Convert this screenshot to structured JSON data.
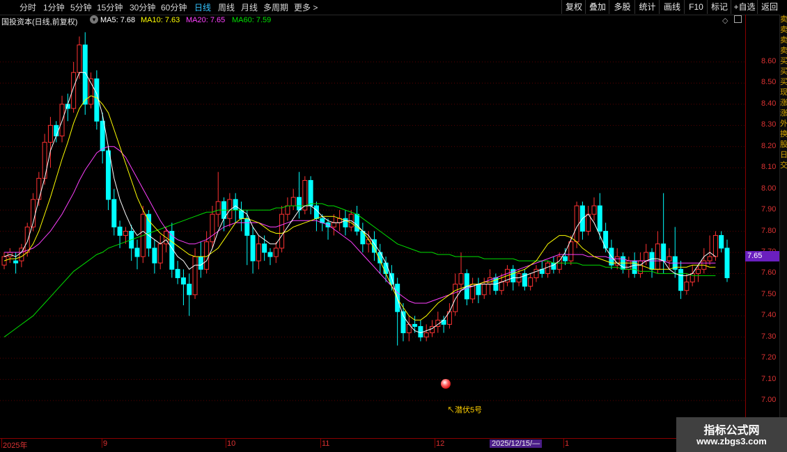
{
  "toolbar": {
    "periods": [
      "分时",
      "1分钟",
      "5分钟",
      "15分钟",
      "30分钟",
      "60分钟",
      "日线",
      "周线",
      "月线",
      "多周期",
      "更多 >"
    ],
    "active_period": "日线",
    "buttons": [
      "复权",
      "叠加",
      "多股",
      "统计",
      "画线",
      "F10",
      "标记",
      "+自选",
      "返回"
    ]
  },
  "info": {
    "stock": "国投资本(日线,前复权)",
    "ma5": "MA5: 7.68",
    "ma10": "MA10: 7.63",
    "ma20": "MA20: 7.65",
    "ma60": "MA60: 7.59",
    "colors": {
      "ma5": "#ffffff",
      "ma10": "#ffff00",
      "ma20": "#ff40ff",
      "ma60": "#00e000"
    }
  },
  "y_axis": {
    "labels": [
      "8.60",
      "8.50",
      "8.40",
      "8.30",
      "8.20",
      "8.10",
      "8.00",
      "7.90",
      "7.80",
      "7.70",
      "7.60",
      "7.50",
      "7.40",
      "7.30",
      "7.20",
      "7.10",
      "7.00"
    ]
  },
  "price_tag": "7.65",
  "x_axis": {
    "labels": [
      "2025年",
      "9",
      "10",
      "11",
      "12",
      "1"
    ],
    "selected_date": "2025/12/15/—"
  },
  "signal_label": "↖潜伏5号",
  "watermark": {
    "line1": "指标公式网",
    "line2": "www.zbgs3.com"
  },
  "right_strip_text": [
    "卖",
    "卖",
    "卖",
    "卖",
    "买",
    "买",
    "买",
    "现",
    "涨",
    "涨",
    "外",
    "换",
    "股",
    "日",
    "交"
  ],
  "chart_data": {
    "type": "candlestick",
    "title": "国投资本(日线,前复权)",
    "ylim": [
      7.0,
      8.6
    ],
    "up_color": "#ff3232",
    "down_color": "#00ffff",
    "series_ma": [
      {
        "name": "MA5",
        "color": "#ffffff"
      },
      {
        "name": "MA10",
        "color": "#ffff00"
      },
      {
        "name": "MA20",
        "color": "#ff40ff"
      },
      {
        "name": "MA60",
        "color": "#00e000"
      }
    ],
    "candles": [
      [
        7.64,
        7.68,
        7.62,
        7.7
      ],
      [
        7.68,
        7.7,
        7.65,
        7.72
      ],
      [
        7.66,
        7.65,
        7.6,
        7.7
      ],
      [
        7.66,
        7.72,
        7.63,
        7.74
      ],
      [
        7.7,
        7.82,
        7.68,
        7.84
      ],
      [
        7.82,
        7.95,
        7.8,
        7.98
      ],
      [
        7.95,
        8.05,
        7.92,
        8.08
      ],
      [
        8.05,
        8.22,
        8.02,
        8.26
      ],
      [
        8.22,
        8.3,
        8.1,
        8.34
      ],
      [
        8.3,
        8.25,
        8.22,
        8.32
      ],
      [
        8.25,
        8.4,
        8.22,
        8.44
      ],
      [
        8.4,
        8.38,
        8.32,
        8.45
      ],
      [
        8.38,
        8.55,
        8.36,
        8.6
      ],
      [
        8.55,
        8.68,
        8.52,
        8.72
      ],
      [
        8.68,
        8.4,
        8.35,
        8.74
      ],
      [
        8.4,
        8.52,
        8.38,
        8.55
      ],
      [
        8.52,
        8.32,
        8.28,
        8.56
      ],
      [
        8.32,
        8.18,
        8.12,
        8.36
      ],
      [
        8.18,
        7.95,
        7.9,
        8.2
      ],
      [
        7.95,
        7.82,
        7.78,
        8.0
      ],
      [
        7.82,
        7.78,
        7.72,
        7.85
      ],
      [
        7.78,
        7.8,
        7.74,
        7.82
      ],
      [
        7.8,
        7.72,
        7.66,
        7.83
      ],
      [
        7.72,
        7.68,
        7.62,
        7.76
      ],
      [
        7.68,
        7.88,
        7.65,
        7.92
      ],
      [
        7.88,
        7.72,
        7.68,
        7.9
      ],
      [
        7.72,
        7.65,
        7.6,
        7.76
      ],
      [
        7.65,
        7.74,
        7.62,
        7.78
      ],
      [
        7.74,
        7.8,
        7.7,
        7.82
      ],
      [
        7.8,
        7.62,
        7.58,
        7.84
      ],
      [
        7.62,
        7.58,
        7.55,
        7.66
      ],
      [
        7.58,
        7.55,
        7.45,
        7.62
      ],
      [
        7.55,
        7.5,
        7.4,
        7.6
      ],
      [
        7.5,
        7.68,
        7.48,
        7.72
      ],
      [
        7.68,
        7.62,
        7.58,
        7.75
      ],
      [
        7.62,
        7.75,
        7.6,
        7.8
      ],
      [
        7.75,
        7.88,
        7.72,
        7.92
      ],
      [
        7.88,
        7.94,
        7.82,
        8.08
      ],
      [
        7.94,
        7.86,
        7.8,
        7.96
      ],
      [
        7.86,
        7.95,
        7.82,
        7.98
      ],
      [
        7.95,
        7.9,
        7.84,
        7.98
      ],
      [
        7.9,
        7.86,
        7.8,
        7.94
      ],
      [
        7.86,
        7.78,
        7.64,
        7.9
      ],
      [
        7.78,
        7.66,
        7.6,
        7.82
      ],
      [
        7.66,
        7.74,
        7.62,
        7.78
      ],
      [
        7.74,
        7.7,
        7.66,
        7.78
      ],
      [
        7.7,
        7.68,
        7.64,
        7.72
      ],
      [
        7.68,
        7.72,
        7.65,
        7.75
      ],
      [
        7.72,
        7.88,
        7.7,
        7.92
      ],
      [
        7.88,
        7.92,
        7.85,
        7.96
      ],
      [
        7.92,
        7.96,
        7.9,
        8.0
      ],
      [
        7.96,
        7.9,
        7.86,
        8.08
      ],
      [
        7.9,
        8.04,
        7.88,
        8.06
      ],
      [
        8.04,
        7.92,
        7.88,
        8.06
      ],
      [
        7.92,
        7.86,
        7.8,
        7.94
      ],
      [
        7.86,
        7.84,
        7.8,
        7.88
      ],
      [
        7.84,
        7.82,
        7.76,
        7.86
      ],
      [
        7.82,
        7.84,
        7.78,
        7.88
      ],
      [
        7.84,
        7.86,
        7.8,
        7.9
      ],
      [
        7.86,
        7.82,
        7.78,
        7.9
      ],
      [
        7.82,
        7.88,
        7.8,
        7.9
      ],
      [
        7.88,
        7.8,
        7.78,
        7.92
      ],
      [
        7.8,
        7.74,
        7.7,
        7.84
      ],
      [
        7.74,
        7.76,
        7.7,
        7.8
      ],
      [
        7.76,
        7.7,
        7.66,
        7.8
      ],
      [
        7.7,
        7.65,
        7.6,
        7.74
      ],
      [
        7.65,
        7.6,
        7.56,
        7.68
      ],
      [
        7.6,
        7.55,
        7.52,
        7.64
      ],
      [
        7.55,
        7.42,
        7.26,
        7.58
      ],
      [
        7.42,
        7.32,
        7.28,
        7.46
      ],
      [
        7.32,
        7.36,
        7.28,
        7.4
      ],
      [
        7.36,
        7.35,
        7.32,
        7.4
      ],
      [
        7.35,
        7.3,
        7.28,
        7.38
      ],
      [
        7.3,
        7.32,
        7.28,
        7.36
      ],
      [
        7.32,
        7.35,
        7.3,
        7.38
      ],
      [
        7.35,
        7.38,
        7.32,
        7.42
      ],
      [
        7.38,
        7.36,
        7.32,
        7.4
      ],
      [
        7.36,
        7.42,
        7.34,
        7.46
      ],
      [
        7.42,
        7.55,
        7.4,
        7.6
      ],
      [
        7.55,
        7.6,
        7.52,
        7.7
      ],
      [
        7.6,
        7.48,
        7.45,
        7.62
      ],
      [
        7.48,
        7.55,
        7.46,
        7.58
      ],
      [
        7.55,
        7.5,
        7.46,
        7.58
      ],
      [
        7.5,
        7.55,
        7.48,
        7.58
      ],
      [
        7.55,
        7.58,
        7.5,
        7.62
      ],
      [
        7.58,
        7.52,
        7.5,
        7.6
      ],
      [
        7.52,
        7.56,
        7.5,
        7.6
      ],
      [
        7.56,
        7.62,
        7.54,
        7.64
      ],
      [
        7.62,
        7.56,
        7.52,
        7.64
      ],
      [
        7.56,
        7.6,
        7.54,
        7.62
      ],
      [
        7.6,
        7.54,
        7.52,
        7.62
      ],
      [
        7.54,
        7.58,
        7.52,
        7.6
      ],
      [
        7.58,
        7.62,
        7.56,
        7.64
      ],
      [
        7.62,
        7.6,
        7.58,
        7.66
      ],
      [
        7.6,
        7.65,
        7.58,
        7.66
      ],
      [
        7.65,
        7.62,
        7.6,
        7.68
      ],
      [
        7.62,
        7.68,
        7.6,
        7.7
      ],
      [
        7.68,
        7.66,
        7.64,
        7.72
      ],
      [
        7.66,
        7.75,
        7.64,
        7.78
      ],
      [
        7.75,
        7.92,
        7.72,
        7.94
      ],
      [
        7.92,
        7.8,
        7.76,
        7.94
      ],
      [
        7.8,
        7.88,
        7.78,
        7.92
      ],
      [
        7.88,
        7.92,
        7.85,
        7.96
      ],
      [
        7.92,
        7.8,
        7.76,
        7.98
      ],
      [
        7.8,
        7.72,
        7.7,
        7.84
      ],
      [
        7.72,
        7.64,
        7.62,
        7.76
      ],
      [
        7.64,
        7.68,
        7.62,
        7.72
      ],
      [
        7.68,
        7.62,
        7.6,
        7.7
      ],
      [
        7.62,
        7.66,
        7.58,
        7.68
      ],
      [
        7.66,
        7.6,
        7.58,
        7.7
      ],
      [
        7.6,
        7.66,
        7.58,
        7.7
      ],
      [
        7.66,
        7.7,
        7.64,
        7.74
      ],
      [
        7.7,
        7.62,
        7.58,
        7.72
      ],
      [
        7.62,
        7.74,
        7.6,
        7.8
      ],
      [
        7.74,
        7.66,
        7.6,
        7.98
      ],
      [
        7.66,
        7.68,
        7.62,
        7.72
      ],
      [
        7.68,
        7.62,
        7.58,
        7.82
      ],
      [
        7.62,
        7.52,
        7.48,
        7.66
      ],
      [
        7.52,
        7.56,
        7.5,
        7.6
      ],
      [
        7.56,
        7.6,
        7.54,
        7.64
      ],
      [
        7.6,
        7.62,
        7.56,
        7.64
      ],
      [
        7.62,
        7.66,
        7.6,
        7.72
      ],
      [
        7.66,
        7.68,
        7.64,
        7.78
      ],
      [
        7.68,
        7.78,
        7.66,
        7.8
      ],
      [
        7.78,
        7.72,
        7.7,
        7.8
      ],
      [
        7.72,
        7.58,
        7.56,
        7.76
      ]
    ],
    "ma5": [
      7.68,
      7.69,
      7.68,
      7.7,
      7.75,
      7.84,
      7.95,
      8.05,
      8.18,
      8.25,
      8.32,
      8.4,
      8.48,
      8.55,
      8.55,
      8.5,
      8.45,
      8.35,
      8.2,
      8.05,
      7.95,
      7.88,
      7.82,
      7.78,
      7.8,
      7.78,
      7.76,
      7.74,
      7.76,
      7.72,
      7.68,
      7.66,
      7.62,
      7.64,
      7.64,
      7.66,
      7.72,
      7.8,
      7.86,
      7.9,
      7.92,
      7.9,
      7.88,
      7.82,
      7.78,
      7.76,
      7.74,
      7.74,
      7.78,
      7.82,
      7.86,
      7.9,
      7.92,
      7.92,
      7.9,
      7.87,
      7.85,
      7.84,
      7.84,
      7.85,
      7.85,
      7.83,
      7.8,
      7.78,
      7.74,
      7.7,
      7.65,
      7.58,
      7.48,
      7.4,
      7.36,
      7.33,
      7.32,
      7.33,
      7.34,
      7.36,
      7.38,
      7.42,
      7.48,
      7.52,
      7.54,
      7.54,
      7.55,
      7.55,
      7.55,
      7.55,
      7.56,
      7.57,
      7.58,
      7.58,
      7.59,
      7.6,
      7.61,
      7.62,
      7.63,
      7.64,
      7.66,
      7.7,
      7.76,
      7.82,
      7.86,
      7.88,
      7.84,
      7.78,
      7.72,
      7.68,
      7.65,
      7.63,
      7.63,
      7.64,
      7.64,
      7.66,
      7.67,
      7.67,
      7.66,
      7.62,
      7.6,
      7.59,
      7.59,
      7.6,
      7.64,
      7.68,
      7.7,
      7.68
    ],
    "ma10": [
      7.66,
      7.67,
      7.67,
      7.68,
      7.7,
      7.74,
      7.8,
      7.88,
      7.96,
      8.05,
      8.14,
      8.22,
      8.31,
      8.38,
      8.42,
      8.44,
      8.43,
      8.4,
      8.36,
      8.28,
      8.2,
      8.12,
      8.04,
      7.96,
      7.9,
      7.85,
      7.82,
      7.79,
      7.77,
      7.75,
      7.73,
      7.71,
      7.69,
      7.68,
      7.68,
      7.68,
      7.7,
      7.72,
      7.76,
      7.8,
      7.84,
      7.86,
      7.86,
      7.85,
      7.84,
      7.82,
      7.8,
      7.79,
      7.79,
      7.8,
      7.82,
      7.83,
      7.84,
      7.85,
      7.86,
      7.87,
      7.87,
      7.87,
      7.86,
      7.85,
      7.84,
      7.82,
      7.8,
      7.76,
      7.72,
      7.66,
      7.6,
      7.54,
      7.48,
      7.44,
      7.4,
      7.38,
      7.38,
      7.4,
      7.43,
      7.46,
      7.48,
      7.5,
      7.52,
      7.53,
      7.54,
      7.55,
      7.55,
      7.56,
      7.56,
      7.57,
      7.58,
      7.59,
      7.6,
      7.61,
      7.62,
      7.64,
      7.66,
      7.7,
      7.74,
      7.76,
      7.78,
      7.78,
      7.77,
      7.75,
      7.72,
      7.7,
      7.68,
      7.67,
      7.66,
      7.65,
      7.65,
      7.65,
      7.65,
      7.65,
      7.64,
      7.63,
      7.62,
      7.62,
      7.62,
      7.62,
      7.63,
      7.63,
      7.63,
      7.64,
      7.64,
      7.64,
      7.63,
      7.63
    ],
    "ma20": [
      7.7,
      7.7,
      7.7,
      7.7,
      7.71,
      7.72,
      7.74,
      7.77,
      7.8,
      7.84,
      7.88,
      7.93,
      7.98,
      8.04,
      8.09,
      8.13,
      8.17,
      8.19,
      8.2,
      8.2,
      8.18,
      8.15,
      8.1,
      8.05,
      8.0,
      7.95,
      7.9,
      7.85,
      7.81,
      7.78,
      7.76,
      7.75,
      7.74,
      7.74,
      7.75,
      7.76,
      7.78,
      7.8,
      7.82,
      7.83,
      7.84,
      7.84,
      7.84,
      7.84,
      7.84,
      7.83,
      7.82,
      7.82,
      7.83,
      7.84,
      7.85,
      7.85,
      7.85,
      7.85,
      7.85,
      7.84,
      7.83,
      7.81,
      7.79,
      7.77,
      7.75,
      7.72,
      7.69,
      7.66,
      7.63,
      7.6,
      7.57,
      7.54,
      7.51,
      7.49,
      7.47,
      7.46,
      7.46,
      7.46,
      7.47,
      7.48,
      7.49,
      7.5,
      7.51,
      7.52,
      7.53,
      7.54,
      7.55,
      7.56,
      7.57,
      7.58,
      7.59,
      7.6,
      7.61,
      7.62,
      7.63,
      7.64,
      7.65,
      7.66,
      7.67,
      7.68,
      7.69,
      7.69,
      7.69,
      7.69,
      7.69,
      7.68,
      7.68,
      7.68,
      7.68,
      7.67,
      7.67,
      7.67,
      7.66,
      7.66,
      7.66,
      7.66,
      7.66,
      7.66,
      7.66,
      7.65,
      7.65,
      7.65,
      7.65,
      7.65,
      7.65,
      7.65,
      7.65,
      7.65
    ],
    "ma60": [
      7.3,
      7.32,
      7.34,
      7.36,
      7.38,
      7.4,
      7.43,
      7.46,
      7.49,
      7.52,
      7.55,
      7.58,
      7.61,
      7.63,
      7.65,
      7.67,
      7.69,
      7.7,
      7.72,
      7.73,
      7.74,
      7.75,
      7.76,
      7.77,
      7.78,
      7.79,
      7.8,
      7.81,
      7.82,
      7.83,
      7.84,
      7.85,
      7.86,
      7.87,
      7.88,
      7.89,
      7.89,
      7.9,
      7.9,
      7.9,
      7.9,
      7.9,
      7.9,
      7.9,
      7.9,
      7.9,
      7.9,
      7.91,
      7.91,
      7.92,
      7.92,
      7.92,
      7.92,
      7.93,
      7.93,
      7.93,
      7.92,
      7.92,
      7.91,
      7.9,
      7.89,
      7.88,
      7.86,
      7.84,
      7.82,
      7.8,
      7.78,
      7.76,
      7.74,
      7.73,
      7.72,
      7.71,
      7.7,
      7.7,
      7.7,
      7.69,
      7.69,
      7.69,
      7.68,
      7.68,
      7.68,
      7.68,
      7.68,
      7.67,
      7.67,
      7.67,
      7.67,
      7.67,
      7.67,
      7.66,
      7.66,
      7.66,
      7.66,
      7.66,
      7.66,
      7.65,
      7.65,
      7.65,
      7.65,
      7.65,
      7.64,
      7.64,
      7.64,
      7.64,
      7.63,
      7.63,
      7.63,
      7.62,
      7.62,
      7.62,
      7.61,
      7.61,
      7.61,
      7.6,
      7.6,
      7.6,
      7.6,
      7.6,
      7.6,
      7.59,
      7.59,
      7.59,
      7.59,
      7.59
    ]
  }
}
